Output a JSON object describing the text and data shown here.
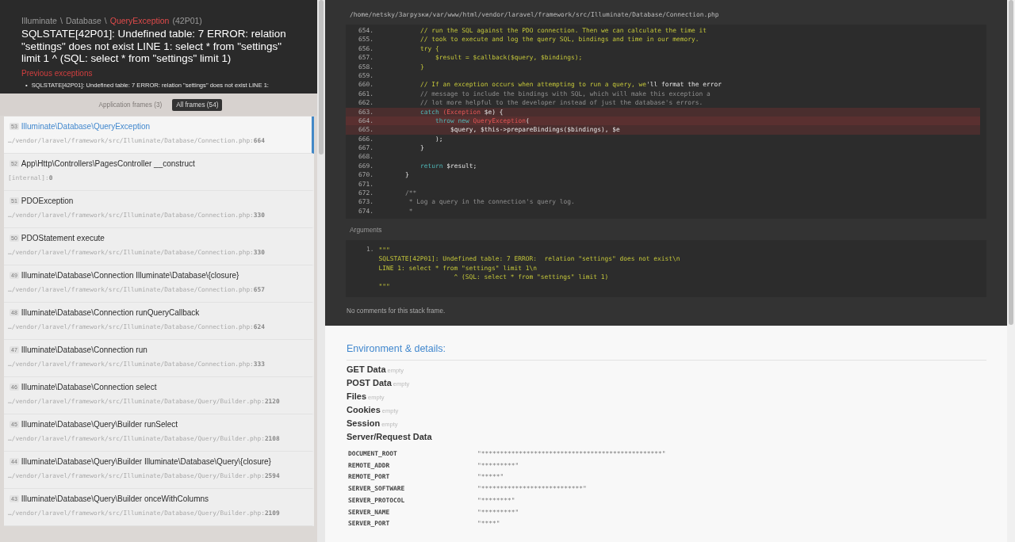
{
  "header": {
    "breadcrumb": [
      {
        "text": "Illuminate",
        "kind": "namespace"
      },
      {
        "text": "\\",
        "kind": "sep"
      },
      {
        "text": "Database",
        "kind": "namespace"
      },
      {
        "text": "\\",
        "kind": "sep"
      },
      {
        "text": "QueryException",
        "kind": "class"
      },
      {
        "text": "(42P01)",
        "kind": "code"
      }
    ],
    "title": "SQLSTATE[42P01]: Undefined table: 7 ERROR: relation \"settings\" does not exist LINE 1: select * from \"settings\" limit 1 ^ (SQL: select * from \"settings\" limit 1)",
    "previous_label": "Previous exceptions",
    "previous": [
      {
        "marker": "•",
        "text": "SQLSTATE[42P01]: Undefined table: 7 ERROR: relation \"settings\" does not exist LINE 1:"
      }
    ]
  },
  "frame_tabs": [
    {
      "label": "Application frames (3)",
      "selected": false
    },
    {
      "label": "All frames (54)",
      "selected": true
    }
  ],
  "frames": [
    {
      "index": "53",
      "name": "Illuminate\\Database\\QueryException",
      "file": "…/vendor/laravel/framework/src/Illuminate/Database/Connection.php:",
      "line": "664",
      "selected": true
    },
    {
      "index": "52",
      "name": "App\\Http\\Controllers\\PagesController __construct",
      "file": "[internal]:",
      "line": "0",
      "selected": false
    },
    {
      "index": "51",
      "name": "PDOException",
      "file": "…/vendor/laravel/framework/src/Illuminate/Database/Connection.php:",
      "line": "330",
      "selected": false
    },
    {
      "index": "50",
      "name": "PDOStatement execute",
      "file": "…/vendor/laravel/framework/src/Illuminate/Database/Connection.php:",
      "line": "330",
      "selected": false
    },
    {
      "index": "49",
      "name": "Illuminate\\Database\\Connection Illuminate\\Database\\{closure}",
      "file": "…/vendor/laravel/framework/src/Illuminate/Database/Connection.php:",
      "line": "657",
      "selected": false
    },
    {
      "index": "48",
      "name": "Illuminate\\Database\\Connection runQueryCallback",
      "file": "…/vendor/laravel/framework/src/Illuminate/Database/Connection.php:",
      "line": "624",
      "selected": false
    },
    {
      "index": "47",
      "name": "Illuminate\\Database\\Connection run",
      "file": "…/vendor/laravel/framework/src/Illuminate/Database/Connection.php:",
      "line": "333",
      "selected": false
    },
    {
      "index": "46",
      "name": "Illuminate\\Database\\Connection select",
      "file": "…/vendor/laravel/framework/src/Illuminate/Database/Query/Builder.php:",
      "line": "2120",
      "selected": false
    },
    {
      "index": "45",
      "name": "Illuminate\\Database\\Query\\Builder runSelect",
      "file": "…/vendor/laravel/framework/src/Illuminate/Database/Query/Builder.php:",
      "line": "2108",
      "selected": false
    },
    {
      "index": "44",
      "name": "Illuminate\\Database\\Query\\Builder Illuminate\\Database\\Query\\{closure}",
      "file": "…/vendor/laravel/framework/src/Illuminate/Database/Query/Builder.php:",
      "line": "2594",
      "selected": false
    },
    {
      "index": "43",
      "name": "Illuminate\\Database\\Query\\Builder onceWithColumns",
      "file": "…/vendor/laravel/framework/src/Illuminate/Database/Query/Builder.php:",
      "line": "2109",
      "selected": false
    }
  ],
  "code": {
    "path": "/home/netsky/Загрузки/var/www/html/vendor/laravel/framework/src/Illuminate/Database/Connection.php",
    "lines": [
      {
        "n": "654.",
        "highlighted": false,
        "current": false,
        "segs": [
          {
            "kind": "string",
            "text": "        // run the SQL against the PDO connection. Then we can calculate the time it"
          }
        ]
      },
      {
        "n": "655.",
        "highlighted": false,
        "current": false,
        "segs": [
          {
            "kind": "string",
            "text": "        // took to execute and log the query SQL, bindings and time in our memory."
          }
        ]
      },
      {
        "n": "656.",
        "highlighted": false,
        "current": false,
        "segs": [
          {
            "kind": "string",
            "text": "        try {"
          }
        ]
      },
      {
        "n": "657.",
        "highlighted": false,
        "current": false,
        "segs": [
          {
            "kind": "string",
            "text": "            $result = $callback($query, $bindings);"
          }
        ]
      },
      {
        "n": "658.",
        "highlighted": false,
        "current": false,
        "segs": [
          {
            "kind": "string",
            "text": "        }"
          }
        ]
      },
      {
        "n": "659.",
        "highlighted": false,
        "current": false
      },
      {
        "n": "660.",
        "highlighted": false,
        "current": false,
        "segs": [
          {
            "kind": "string",
            "text": "        // If an exception occurs when attempting to run a query, we"
          },
          {
            "kind": "plain",
            "text": "'ll format the error"
          }
        ]
      },
      {
        "n": "661.",
        "highlighted": false,
        "current": false,
        "segs": [
          {
            "kind": "comment",
            "text": "        // message to include the bindings with SQL, which will make this exception a"
          }
        ]
      },
      {
        "n": "662.",
        "highlighted": false,
        "current": false,
        "segs": [
          {
            "kind": "comment",
            "text": "        // lot more helpful to the developer instead of just the database's errors."
          }
        ]
      },
      {
        "n": "663.",
        "highlighted": true,
        "current": false,
        "segs": [
          {
            "kind": "keyword",
            "text": "        catch "
          },
          {
            "kind": "class",
            "text": "(Exception"
          },
          {
            "kind": "plain",
            "text": " $e) {"
          }
        ]
      },
      {
        "n": "664.",
        "highlighted": true,
        "current": true,
        "segs": [
          {
            "kind": "keyword",
            "text": "            throw new "
          },
          {
            "kind": "class",
            "text": "QueryException"
          },
          {
            "kind": "plain",
            "text": "("
          }
        ]
      },
      {
        "n": "665.",
        "highlighted": true,
        "current": false,
        "segs": [
          {
            "kind": "plain",
            "text": "                $query, $this->prepareBindings($bindings), $e"
          }
        ]
      },
      {
        "n": "666.",
        "highlighted": false,
        "current": false,
        "segs": [
          {
            "kind": "plain",
            "text": "            );"
          }
        ]
      },
      {
        "n": "667.",
        "highlighted": false,
        "current": false,
        "segs": [
          {
            "kind": "plain",
            "text": "        }"
          }
        ]
      },
      {
        "n": "668.",
        "highlighted": false,
        "current": false
      },
      {
        "n": "669.",
        "highlighted": false,
        "current": false,
        "segs": [
          {
            "kind": "keyword",
            "text": "        return "
          },
          {
            "kind": "plain",
            "text": "$result;"
          }
        ]
      },
      {
        "n": "670.",
        "highlighted": false,
        "current": false,
        "segs": [
          {
            "kind": "plain",
            "text": "    }"
          }
        ]
      },
      {
        "n": "671.",
        "highlighted": false,
        "current": false
      },
      {
        "n": "672.",
        "highlighted": false,
        "current": false,
        "segs": [
          {
            "kind": "comment",
            "text": "    /**"
          }
        ]
      },
      {
        "n": "673.",
        "highlighted": false,
        "current": false,
        "segs": [
          {
            "kind": "comment",
            "text": "     * Log a query in the connection's query log."
          }
        ]
      },
      {
        "n": "674.",
        "highlighted": false,
        "current": false,
        "segs": [
          {
            "kind": "comment",
            "text": "     *"
          }
        ]
      }
    ]
  },
  "arguments": {
    "label": "Arguments",
    "items": [
      {
        "number": "1.",
        "lines": [
          "\"\"\"",
          "SQLSTATE[42P01]: Undefined table: 7 ERROR:  relation \"settings\" does not exist\\n",
          "LINE 1: select * from \"settings\" limit 1\\n",
          "                    ^ (SQL: select * from \"settings\" limit 1)",
          "\"\"\""
        ]
      }
    ]
  },
  "frame_comments": "No comments for this stack frame.",
  "environment": {
    "title": "Environment & details:",
    "sections": [
      {
        "label": "GET Data",
        "note": "empty"
      },
      {
        "label": "POST Data",
        "note": "empty"
      },
      {
        "label": "Files",
        "note": "empty"
      },
      {
        "label": "Cookies",
        "note": "empty"
      },
      {
        "label": "Session",
        "note": "empty"
      },
      {
        "label": "Server/Request Data"
      }
    ],
    "server": [
      {
        "key": "DOCUMENT_ROOT",
        "value": "\"************************************************\""
      },
      {
        "key": "REMOTE_ADDR",
        "value": "\"*********\""
      },
      {
        "key": "REMOTE_PORT",
        "value": "\"*****\""
      },
      {
        "key": "SERVER_SOFTWARE",
        "value": "\"***************************\""
      },
      {
        "key": "SERVER_PROTOCOL",
        "value": "\"********\""
      },
      {
        "key": "SERVER_NAME",
        "value": "\"*********\""
      },
      {
        "key": "SERVER_PORT",
        "value": "\"****\""
      }
    ]
  }
}
